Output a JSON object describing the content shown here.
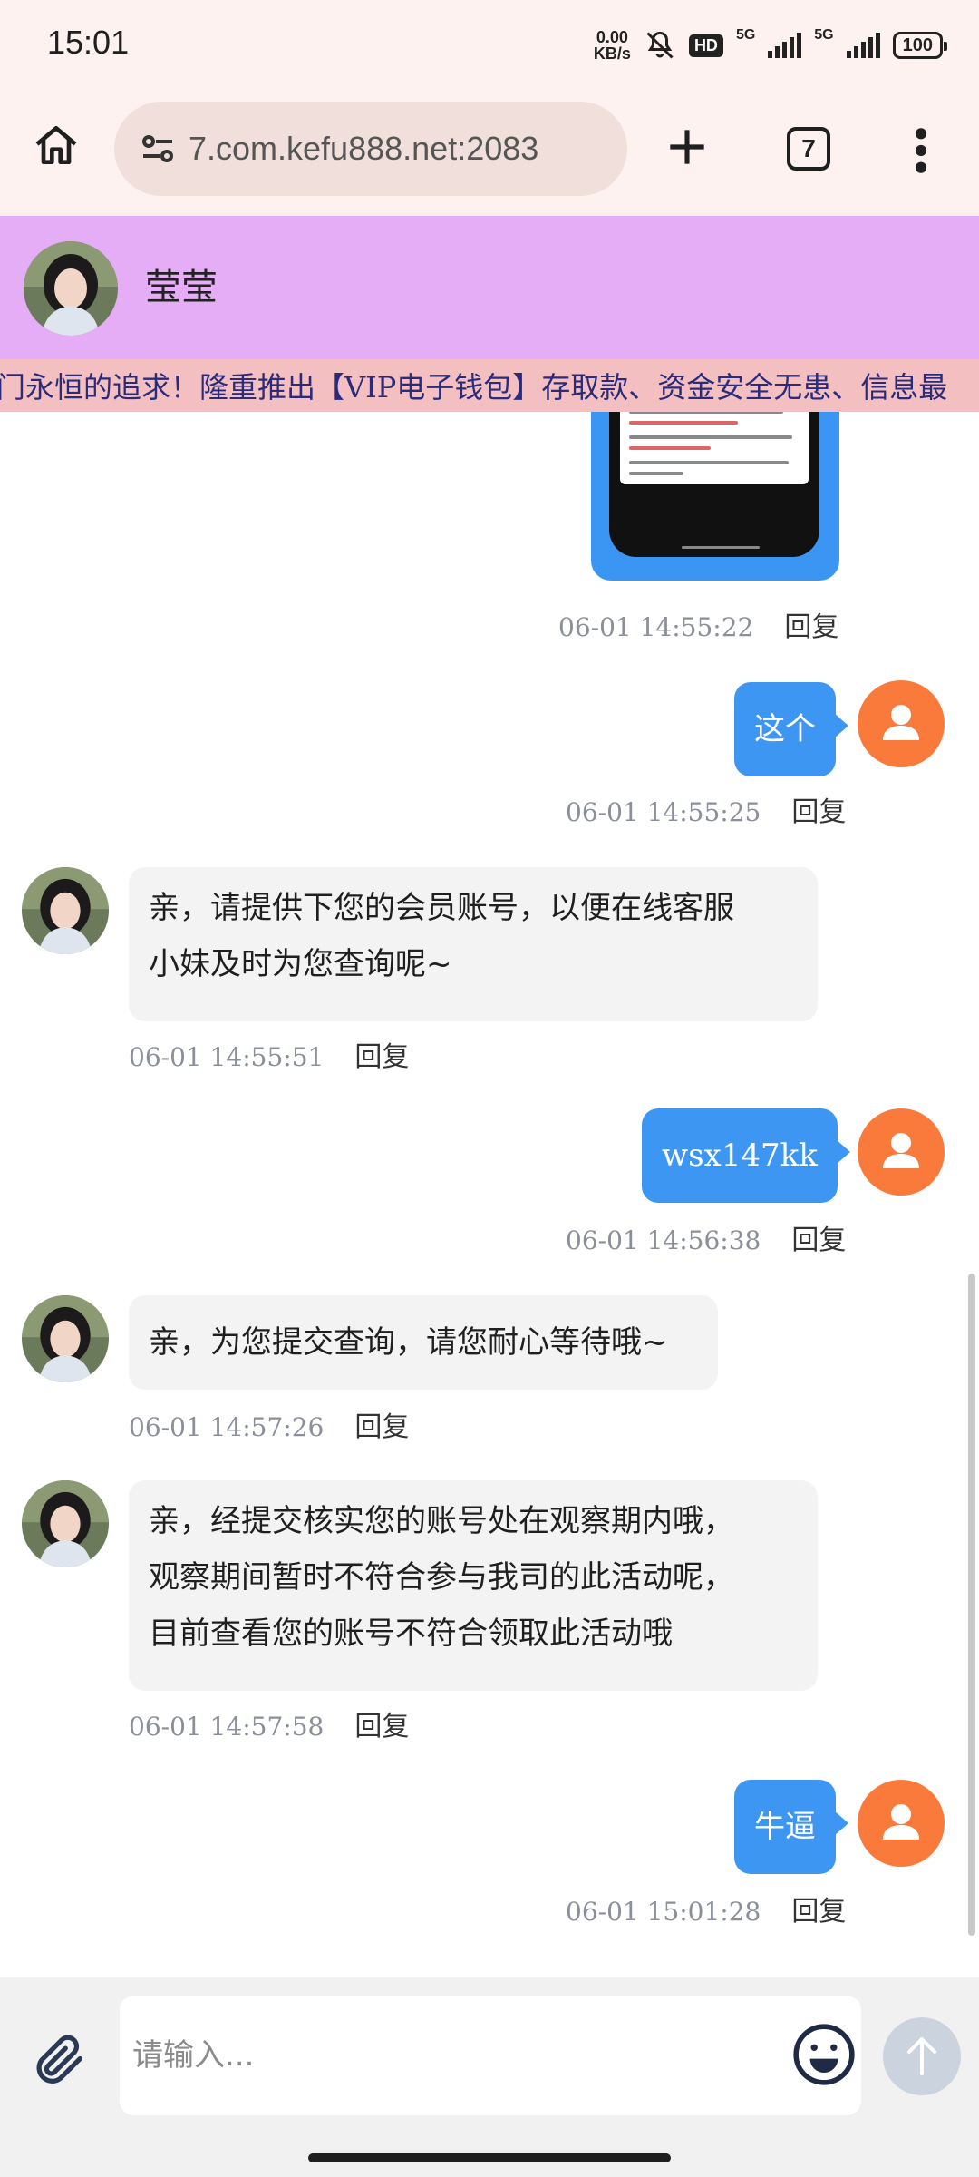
{
  "status_bar": {
    "time": "15:01",
    "net_speed_top": "0.00",
    "net_speed_unit": "KB/s",
    "hd_label": "HD",
    "sim1_label": "5G",
    "sim2_label": "5G",
    "battery": "100"
  },
  "browser": {
    "url": "7.com.kefu888.net:2083",
    "tab_count": "7"
  },
  "chat_header": {
    "agent_name": "莹莹"
  },
  "marquee": {
    "text": "门永恒的追求！隆重推出【VIP电子钱包】存取款、资金安全无患、信息最"
  },
  "messages": {
    "m0": {
      "timestamp": "06-01 14:55:22",
      "reply": "回复"
    },
    "m1": {
      "text": "这个",
      "timestamp": "06-01 14:55:25",
      "reply": "回复"
    },
    "m2": {
      "line1": "亲，请提供下您的会员账号，以便在线客服",
      "line2": "小妹及时为您查询呢~",
      "timestamp": "06-01 14:55:51",
      "reply": "回复"
    },
    "m3": {
      "text": "wsx147kk",
      "timestamp": "06-01 14:56:38",
      "reply": "回复"
    },
    "m4": {
      "text": "亲，为您提交查询，请您耐心等待哦~",
      "timestamp": "06-01 14:57:26",
      "reply": "回复"
    },
    "m5": {
      "line1": "亲，经提交核实您的账号处在观察期内哦，",
      "line2": "观察期间暂时不符合参与我司的此活动呢，",
      "line3": "目前查看您的账号不符合领取此活动哦",
      "timestamp": "06-01 14:57:58",
      "reply": "回复"
    },
    "m6": {
      "text": "牛逼",
      "timestamp": "06-01 15:01:28",
      "reply": "回复"
    }
  },
  "input": {
    "placeholder": "请输入..."
  },
  "colors": {
    "header_bg": "#e4adf6",
    "marquee_bg": "#f3bfc1",
    "outgoing_bubble": "#3d97f2",
    "incoming_bubble": "#f3f3f3",
    "user_avatar": "#fa7a3c"
  }
}
